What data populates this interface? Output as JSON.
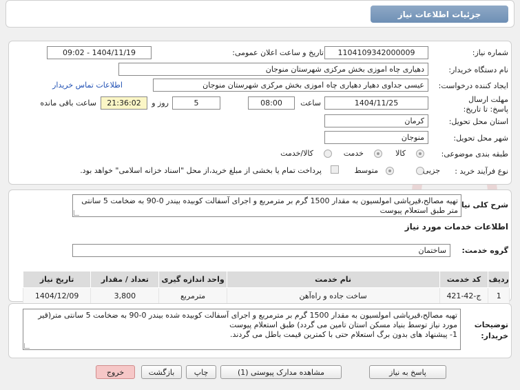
{
  "header": {
    "title": "جزئیات اطلاعات نیاز"
  },
  "form": {
    "need_number_label": "شماره نیاز:",
    "need_number": "1104109342000009",
    "announce_label": "تاریخ و ساعت اعلان عمومی:",
    "announce_value": "1404/11/19 - 09:02",
    "buyer_org_label": "نام دستگاه خریدار:",
    "buyer_org": "دهیاری چاه اموزی بخش مرکزی شهرستان منوجان",
    "creator_label": "ایجاد کننده درخواست:",
    "creator": "عیسی جداوی دهیار دهیاری چاه اموزی بخش مرکزی شهرستان منوجان",
    "contact_link": "اطلاعات تماس خریدار",
    "deadline_label": "مهلت ارسال پاسخ: تا تاریخ:",
    "deadline_date": "1404/11/25",
    "time_label": "ساعت",
    "deadline_time": "08:00",
    "days_value": "5",
    "days_label": "روز و",
    "remaining_time": "21:36:02",
    "remaining_label": "ساعت باقی مانده",
    "province_label": "استان محل تحویل:",
    "province": "کرمان",
    "city_label": "شهر محل تحویل:",
    "city": "منوجان",
    "category_label": "طبقه بندی موضوعی:",
    "category_options": [
      "کالا",
      "خدمت",
      "کالا/خدمت"
    ],
    "process_label": "نوع فرآیند خرید :",
    "process_options": [
      "جزیی",
      "متوسط"
    ],
    "payment_note": "پرداخت تمام یا بخشی از مبلغ خرید،از محل \"اسناد خزانه اسلامی\" خواهد بود."
  },
  "summary": {
    "label": "شرح کلی نیاز:",
    "text": "تهیه مصالح،قیرپاشی امولسیون به مقدار 1500 گرم بر مترمربع و اجرای آسفالت کوبیده بیندر 0-90 به ضخامت 5 سانتی متر طبق استعلام پیوست"
  },
  "services": {
    "section_title": "اطلاعات خدمات مورد نیاز",
    "group_label": "گروه خدمت:",
    "group_value": "ساختمان",
    "columns": [
      "ردیف",
      "کد خدمت",
      "نام خدمت",
      "واحد اندازه گیری",
      "تعداد / مقدار",
      "تاریخ نیاز"
    ],
    "rows": [
      [
        "1",
        "ج-42-421",
        "ساخت جاده و راه‌آهن",
        "مترمربع",
        "3,800",
        "1404/12/09"
      ]
    ]
  },
  "buyer_notes": {
    "label": "توضیحات خریدار:",
    "text": "تهیه مصالح،قیرپاشی امولسیون به مقدار 1500 گرم بر مترمربع و اجرای آسفالت کوبیده شده بیندر 0-90 به ضخامت 5 سانتی متر(قیر مورد نیاز توسط بنیاد مسکن استان تامین می گردد) طبق استعلام پیوست\n1- پیشنهاد های بدون برگ استعلام حتی با کمترین قیمت باطل می گردند."
  },
  "buttons": {
    "reply": "پاسخ به نیاز",
    "attachments": "مشاهده مدارک پیوستی (1)",
    "print": "چاپ",
    "back": "بازگشت",
    "exit": "خروج"
  },
  "colors": {
    "header_blue": "#7b98bb",
    "link_blue": "#1f4fb3",
    "highlight_yellow": "#fbf6c6",
    "exit_pink": "#f6c7c7"
  }
}
